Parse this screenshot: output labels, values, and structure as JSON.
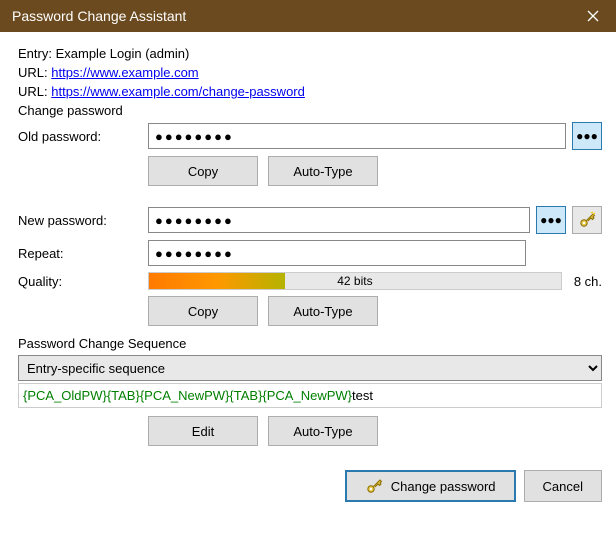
{
  "window": {
    "title": "Password Change Assistant"
  },
  "entry": {
    "label": "Entry:",
    "name": "Example Login (admin)"
  },
  "urls": [
    {
      "label": "URL:",
      "href": "https://www.example.com"
    },
    {
      "label": "URL:",
      "href": "https://www.example.com/change-password"
    }
  ],
  "changePasswordHeading": "Change password",
  "old": {
    "label": "Old password:",
    "mask": "●●●●●●●●",
    "copy": "Copy",
    "autotype": "Auto-Type"
  },
  "new": {
    "label": "New password:",
    "mask": "●●●●●●●●",
    "repeatLabel": "Repeat:",
    "repeatMask": "●●●●●●●●",
    "qualityLabel": "Quality:",
    "qualityText": "42 bits",
    "charsText": "8 ch.",
    "copy": "Copy",
    "autotype": "Auto-Type"
  },
  "sequence": {
    "heading": "Password Change Sequence",
    "selected": "Entry-specific sequence",
    "displayGreen": "{PCA_OldPW}{TAB}{PCA_NewPW}{TAB}{PCA_NewPW}",
    "displayBlack": "test",
    "edit": "Edit",
    "autotype": "Auto-Type"
  },
  "footer": {
    "change": "Change password",
    "cancel": "Cancel"
  }
}
